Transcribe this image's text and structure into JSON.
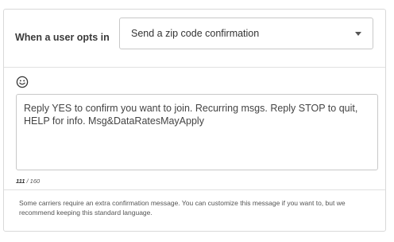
{
  "optin": {
    "label": "When a user opts in",
    "selected_option": "Send a zip code confirmation"
  },
  "message": {
    "emoji_icon": "smiley-face-icon",
    "text": "Reply YES to confirm you want to join. Recurring msgs. Reply STOP to quit, HELP for info. Msg&DataRatesMayApply",
    "count_used": "111",
    "count_sep": " / ",
    "count_max": "160"
  },
  "footer": {
    "note": "Some carriers require an extra confirmation message. You can customize this message if you want to, but we recommend keeping this standard language."
  }
}
